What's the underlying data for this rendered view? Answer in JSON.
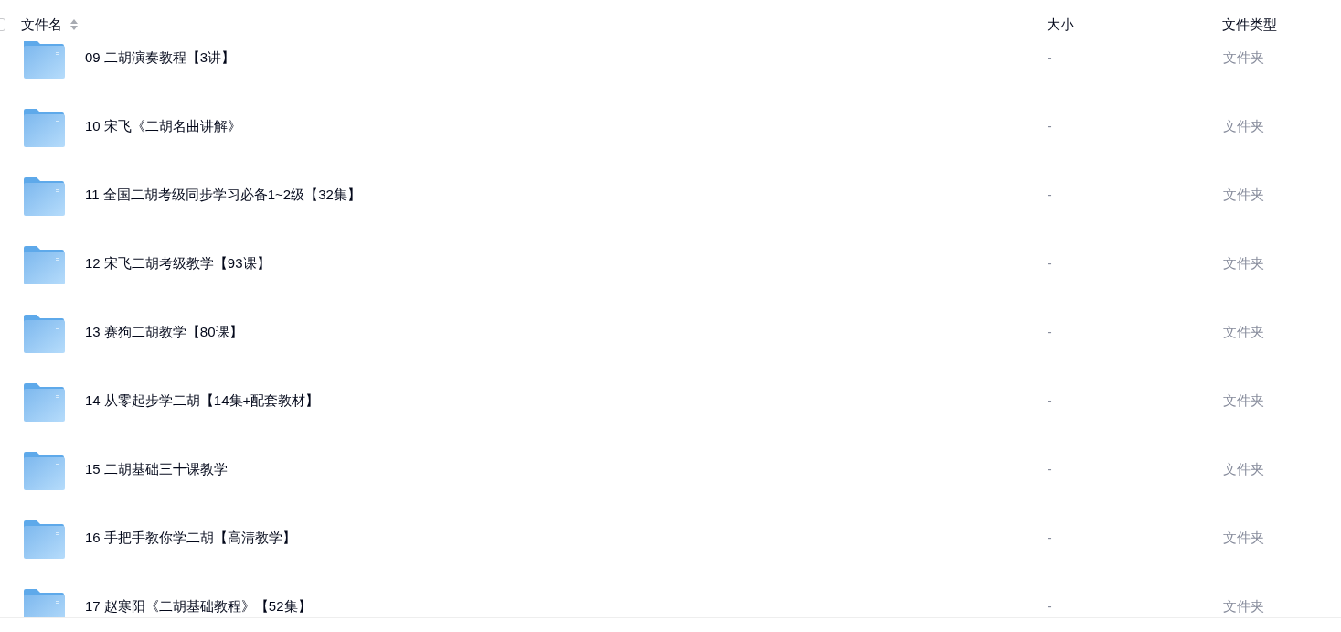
{
  "header": {
    "checked": false,
    "columns": [
      "文件名",
      "大小",
      "文件类型"
    ]
  },
  "rows": [
    {
      "name": "09 二胡演奏教程【3讲】",
      "size": "-",
      "type": "文件夹"
    },
    {
      "name": "10 宋飞《二胡名曲讲解》",
      "size": "-",
      "type": "文件夹"
    },
    {
      "name": "11 全国二胡考级同步学习必备1~2级【32集】",
      "size": "-",
      "type": "文件夹"
    },
    {
      "name": "12 宋飞二胡考级教学【93课】",
      "size": "-",
      "type": "文件夹"
    },
    {
      "name": "13 赛狗二胡教学【80课】",
      "size": "-",
      "type": "文件夹"
    },
    {
      "name": "14 从零起步学二胡【14集+配套教材】",
      "size": "-",
      "type": "文件夹"
    },
    {
      "name": "15 二胡基础三十课教学",
      "size": "-",
      "type": "文件夹"
    },
    {
      "name": "16 手把手教你学二胡【高清教学】",
      "size": "-",
      "type": "文件夹"
    },
    {
      "name": "17 赵寒阳《二胡基础教程》【52集】",
      "size": "-",
      "type": "文件夹"
    }
  ]
}
